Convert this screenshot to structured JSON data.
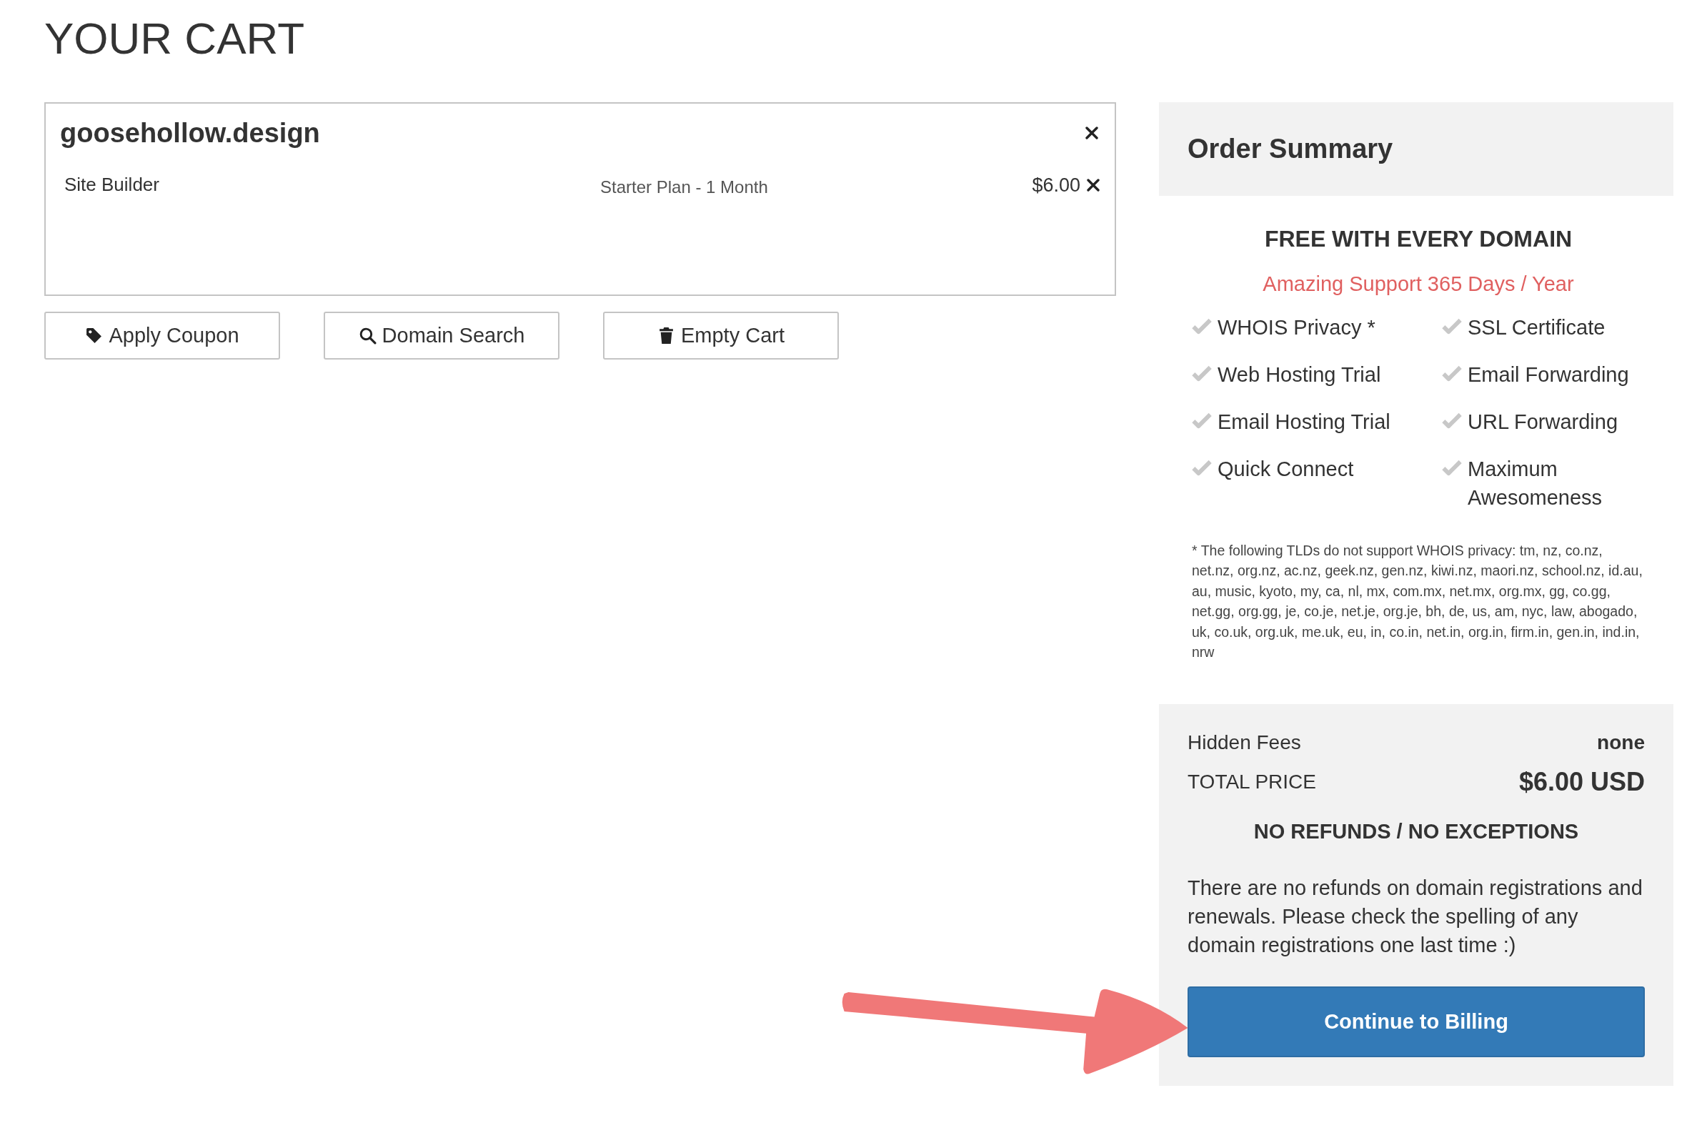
{
  "page": {
    "title": "YOUR CART"
  },
  "cart": {
    "items": [
      {
        "domain": "goosehollow.design",
        "products": [
          {
            "name": "Site Builder",
            "plan": "Starter Plan - 1 Month",
            "price": "$6.00"
          }
        ]
      }
    ],
    "actions": [
      {
        "label": "Apply Coupon",
        "kind": "tag"
      },
      {
        "label": "Domain Search",
        "kind": "search"
      },
      {
        "label": "Empty Cart",
        "kind": "trash"
      }
    ]
  },
  "summary": {
    "title": "Order Summary",
    "free_heading": "FREE WITH EVERY DOMAIN",
    "support": "Amazing Support 365 Days / Year",
    "features": [
      "WHOIS Privacy *",
      "SSL Certificate",
      "Web Hosting Trial",
      "Email Forwarding",
      "Email Hosting Trial",
      "URL Forwarding",
      "Quick Connect",
      "Maximum Awesomeness"
    ],
    "footnote": "* The following TLDs do not support WHOIS privacy: tm, nz, co.nz, net.nz, org.nz, ac.nz, geek.nz, gen.nz, kiwi.nz, maori.nz, school.nz, id.au, au, music, kyoto, my, ca, nl, mx, com.mx, net.mx, org.mx, gg, co.gg, net.gg, org.gg, je, co.je, net.je, org.je, bh, de, us, am, nyc, law, abogado, uk, co.uk, org.uk, me.uk, eu, in, co.in, net.in, org.in, firm.in, gen.in, ind.in, nrw",
    "hidden_fees": {
      "label": "Hidden Fees",
      "value": "none"
    },
    "total": {
      "label": "TOTAL PRICE",
      "value": "$6.00 USD"
    },
    "refund_heading": "NO REFUNDS / NO EXCEPTIONS",
    "refund_text": "There are no refunds on domain registrations and renewals. Please check the spelling of any domain registrations one last time :)",
    "continue_button": "Continue to Billing"
  }
}
